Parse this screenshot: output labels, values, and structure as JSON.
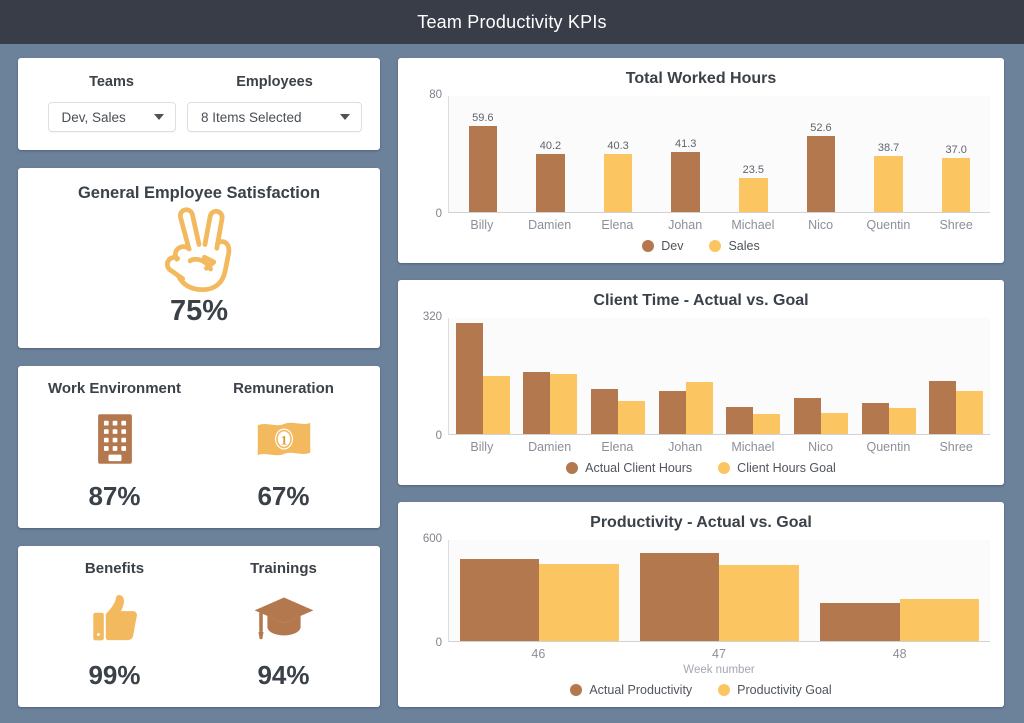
{
  "header": {
    "title": "Team Productivity KPIs"
  },
  "colors": {
    "brown": "#b4784f",
    "orange": "#fbc662",
    "page_bg": "#6c819a",
    "header_bg": "#383d48",
    "text": "#3b4149"
  },
  "filters": {
    "teams": {
      "label": "Teams",
      "value": "Dev, Sales"
    },
    "employees": {
      "label": "Employees",
      "value": "8 Items Selected"
    }
  },
  "kpis": {
    "satisfaction": {
      "title": "General Employee Satisfaction",
      "value": "75%",
      "icon": "victory-hand-icon"
    },
    "work_environment": {
      "title": "Work Environment",
      "value": "87%",
      "icon": "building-icon"
    },
    "remuneration": {
      "title": "Remuneration",
      "value": "67%",
      "icon": "banknote-icon"
    },
    "benefits": {
      "title": "Benefits",
      "value": "99%",
      "icon": "thumbs-up-icon"
    },
    "trainings": {
      "title": "Trainings",
      "value": "94%",
      "icon": "graduation-cap-icon"
    }
  },
  "chart_data": [
    {
      "id": "worked-hours",
      "type": "bar",
      "title": "Total Worked Hours",
      "xlabel": "",
      "ylabel": "",
      "ylim": [
        0,
        80
      ],
      "yticks": [
        "0",
        "80"
      ],
      "grid": false,
      "legend_position": "bottom",
      "legend": [
        {
          "name": "Dev",
          "color": "#b4784f"
        },
        {
          "name": "Sales",
          "color": "#fbc662"
        }
      ],
      "categories": [
        "Billy",
        "Damien",
        "Elena",
        "Johan",
        "Michael",
        "Nico",
        "Quentin",
        "Shree"
      ],
      "values": [
        59.6,
        40.2,
        40.3,
        41.3,
        23.5,
        52.6,
        38.7,
        37.0
      ],
      "value_labels": [
        "59.6",
        "40.2",
        "40.3",
        "41.3",
        "23.5",
        "52.6",
        "38.7",
        "37.0"
      ],
      "bar_teams": [
        "Dev",
        "Dev",
        "Sales",
        "Dev",
        "Sales",
        "Dev",
        "Sales",
        "Sales"
      ]
    },
    {
      "id": "client-time",
      "type": "bar",
      "title": "Client Time - Actual vs. Goal",
      "xlabel": "",
      "ylabel": "",
      "ylim": [
        0,
        320
      ],
      "yticks": [
        "0",
        "320"
      ],
      "grid": false,
      "legend_position": "bottom",
      "legend": [
        {
          "name": "Actual Client Hours",
          "color": "#b4784f"
        },
        {
          "name": "Client Hours Goal",
          "color": "#fbc662"
        }
      ],
      "categories": [
        "Billy",
        "Damien",
        "Elena",
        "Johan",
        "Michael",
        "Nico",
        "Quentin",
        "Shree"
      ],
      "series": [
        {
          "name": "Actual Client Hours",
          "color": "#b4784f",
          "values": [
            305,
            170,
            125,
            118,
            75,
            100,
            85,
            145
          ]
        },
        {
          "name": "Client Hours Goal",
          "color": "#fbc662",
          "values": [
            160,
            165,
            92,
            143,
            55,
            57,
            72,
            118
          ]
        }
      ]
    },
    {
      "id": "productivity",
      "type": "bar",
      "title": "Productivity - Actual vs. Goal",
      "xlabel": "Week number",
      "ylabel": "",
      "ylim": [
        0,
        600
      ],
      "yticks": [
        "0",
        "600"
      ],
      "grid": false,
      "legend_position": "bottom",
      "legend": [
        {
          "name": "Actual Productivity",
          "color": "#b4784f"
        },
        {
          "name": "Productivity Goal",
          "color": "#fbc662"
        }
      ],
      "categories": [
        "46",
        "47",
        "48"
      ],
      "series": [
        {
          "name": "Actual Productivity",
          "color": "#b4784f",
          "values": [
            490,
            520,
            225
          ]
        },
        {
          "name": "Productivity Goal",
          "color": "#fbc662",
          "values": [
            455,
            450,
            250
          ]
        }
      ]
    }
  ]
}
